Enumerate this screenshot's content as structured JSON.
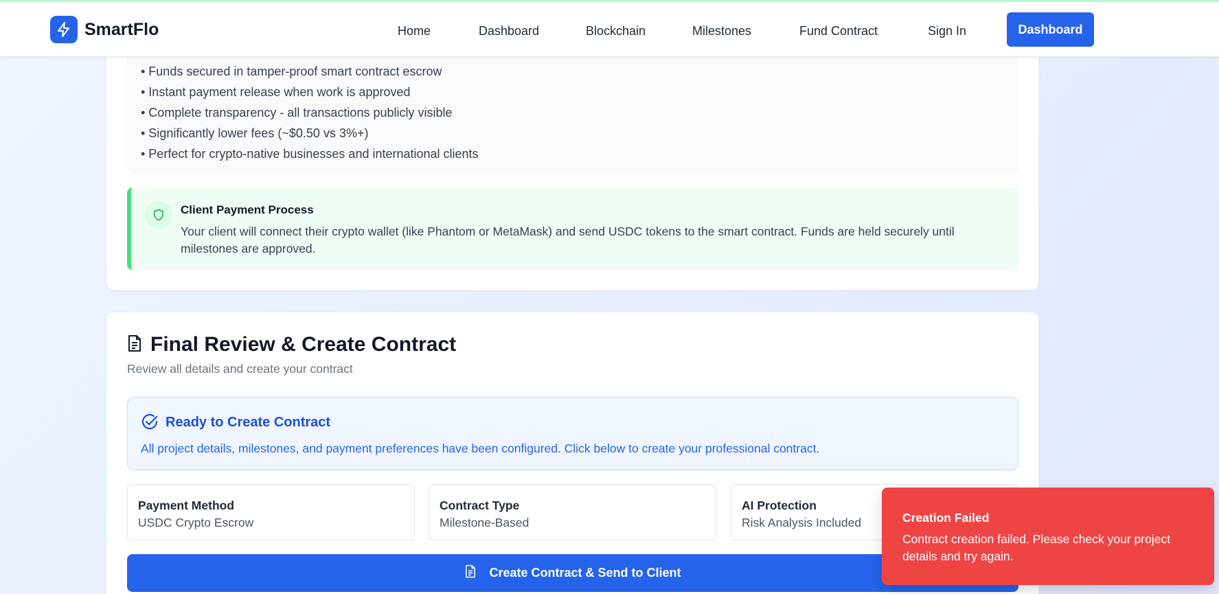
{
  "header": {
    "brand": "SmartFlo",
    "nav": [
      "Home",
      "Dashboard",
      "Blockchain",
      "Milestones",
      "Fund Contract",
      "Sign In"
    ],
    "cta": "Dashboard"
  },
  "benefits": [
    "• Funds secured in tamper-proof smart contract escrow",
    "• Instant payment release when work is approved",
    "• Complete transparency - all transactions publicly visible",
    "• Significantly lower fees (~$0.50 vs 3%+)",
    "• Perfect for crypto-native businesses and international clients"
  ],
  "process": {
    "title": "Client Payment Process",
    "text": "Your client will connect their crypto wallet (like Phantom or MetaMask) and send USDC tokens to the smart contract. Funds are held securely until milestones are approved."
  },
  "review": {
    "title": "Final Review & Create Contract",
    "subtitle": "Review all details and create your contract",
    "ready_title": "Ready to Create Contract",
    "ready_text": "All project details, milestones, and payment preferences have been configured. Click below to create your professional contract.",
    "tiles": [
      {
        "label": "Payment Method",
        "value": "USDC Crypto Escrow"
      },
      {
        "label": "Contract Type",
        "value": "Milestone-Based"
      },
      {
        "label": "AI Protection",
        "value": "Risk Analysis Included"
      }
    ],
    "create_button": "Create Contract & Send to Client"
  },
  "toast": {
    "title": "Creation Failed",
    "text": "Contract creation failed. Please check your project details and try again."
  },
  "colors": {
    "primary": "#2563eb",
    "success_bg": "#f0fdf4",
    "success_border": "#4ade80",
    "error": "#ef4444"
  }
}
